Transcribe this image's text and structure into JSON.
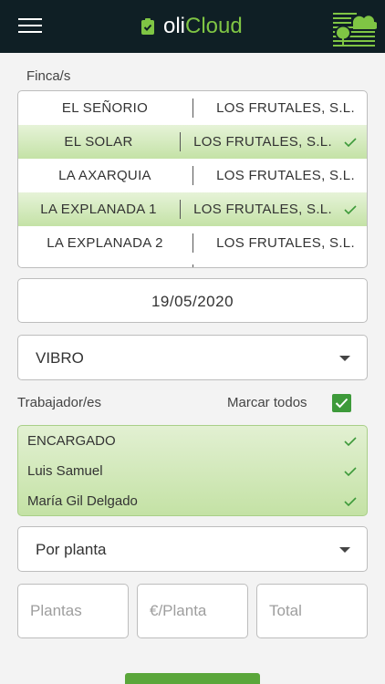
{
  "header": {
    "brand_prefix": "oli",
    "brand_suffix": "Cloud",
    "menu_icon": "hamburger-icon",
    "brand_icon": "clipboard-check-icon",
    "logo_icon": "tree-cloud-logo"
  },
  "fincas": {
    "label": "Finca/s",
    "rows": [
      {
        "name": "EL SEÑORIO",
        "owner": "LOS FRUTALES, S.L.",
        "selected": false
      },
      {
        "name": "EL SOLAR",
        "owner": "LOS FRUTALES, S.L.",
        "selected": true
      },
      {
        "name": "LA AXARQUIA",
        "owner": "LOS FRUTALES, S.L.",
        "selected": false
      },
      {
        "name": "LA EXPLANADA 1",
        "owner": "LOS FRUTALES, S.L.",
        "selected": true
      },
      {
        "name": "LA EXPLANADA 2",
        "owner": "LOS FRUTALES, S.L.",
        "selected": false
      }
    ]
  },
  "date": {
    "value": "19/05/2020"
  },
  "task": {
    "value": "VIBRO"
  },
  "workers": {
    "label": "Trabajador/es",
    "select_all_label": "Marcar todos",
    "select_all_checked": true,
    "items": [
      {
        "name": "ENCARGADO",
        "selected": true
      },
      {
        "name": "Luis Samuel",
        "selected": true
      },
      {
        "name": "María Gil Delgado",
        "selected": true
      }
    ]
  },
  "mode": {
    "value": "Por planta"
  },
  "inputs": {
    "plantas_placeholder": "Plantas",
    "precio_placeholder": "€/Planta",
    "total_placeholder": "Total"
  },
  "colors": {
    "topbar": "#0f1f25",
    "accent_green": "#7fc544",
    "check_green": "#3d9a3a",
    "selection_green": "#c4e2a6"
  }
}
